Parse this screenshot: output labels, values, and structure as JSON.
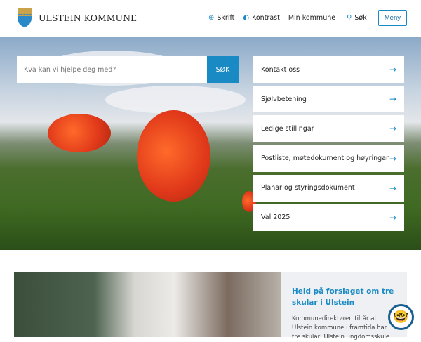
{
  "header": {
    "logo_text": "ULSTEIN KOMMUNE",
    "nav": [
      {
        "icon": "zoom-icon",
        "label": "Skrift"
      },
      {
        "icon": "contrast-icon",
        "label": "Kontrast"
      },
      {
        "icon": "",
        "label": "Min kommune"
      },
      {
        "icon": "search-icon",
        "label": "Søk"
      }
    ],
    "menu_label": "Meny"
  },
  "search": {
    "placeholder": "Kva kan vi hjelpe deg med?",
    "button_label": "SØK"
  },
  "quick_links": [
    "Kontakt oss",
    "Sjølvbetening",
    "Ledige stillingar",
    "Postliste, møtedokument og høyringar",
    "Planar og styringsdokument",
    "Val 2025"
  ],
  "news": {
    "title": "Held på forslaget om tre skular i Ulstein",
    "text": "Kommunedirektøren tilrår at Ulstein kommune i framtida har tre skular: Ulstein ungdomsskule"
  },
  "colors": {
    "accent": "#1a8ac4"
  }
}
